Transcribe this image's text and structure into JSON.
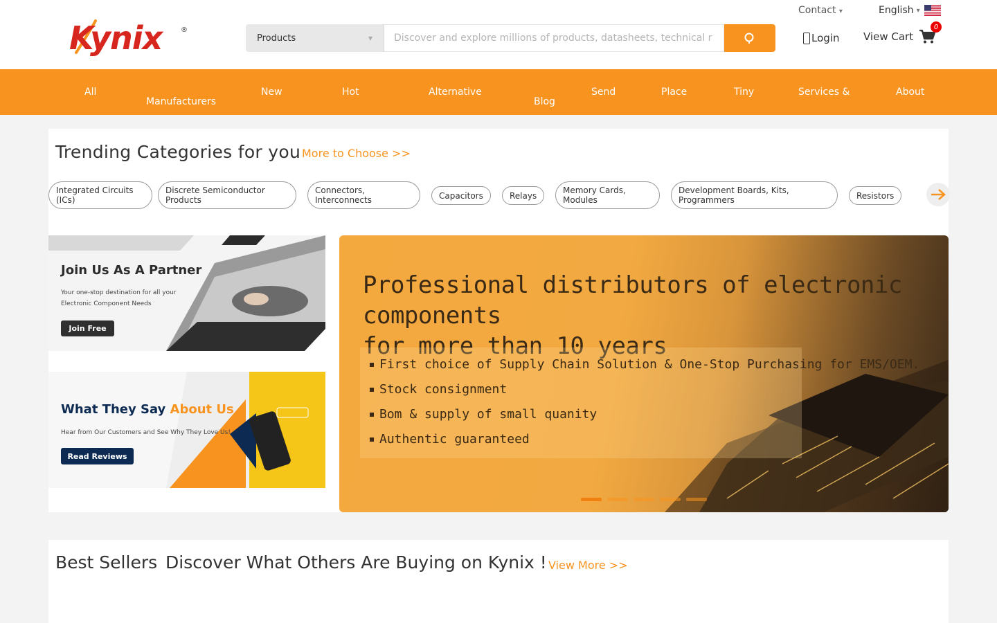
{
  "header": {
    "logo_text": "Kynix",
    "logo_mark": "®",
    "search": {
      "category": "Products",
      "placeholder": "Discover and explore millions of products, datasheets, technical r"
    },
    "contact_label": "Contact",
    "language_label": "English",
    "login_label": "Login",
    "cart_label": "View Cart",
    "cart_count": "0"
  },
  "nav": {
    "items": [
      {
        "label": "All",
        "label2": ""
      },
      {
        "label": "",
        "label2": "Manufacturers"
      },
      {
        "label": "New",
        "label2": ""
      },
      {
        "label": "Hot",
        "label2": ""
      },
      {
        "label": "Alternative",
        "label2": ""
      },
      {
        "label": "",
        "label2": "Blog"
      },
      {
        "label": "Send",
        "label2": ""
      },
      {
        "label": "Place",
        "label2": ""
      },
      {
        "label": "Tiny",
        "label2": ""
      },
      {
        "label": "Services &",
        "label2": ""
      },
      {
        "label": "About",
        "label2": ""
      }
    ]
  },
  "trending": {
    "title": "Trending Categories for you",
    "more_label": "More to Choose >>",
    "categories": [
      {
        "line1": "Integrated Circuits",
        "line2": "(ICs)"
      },
      {
        "line1": "Discrete Semiconductor",
        "line2": "Products"
      },
      {
        "line1": "Connectors,",
        "line2": "Interconnects"
      },
      {
        "line1": "Capacitors",
        "line2": ""
      },
      {
        "line1": "Relays",
        "line2": ""
      },
      {
        "line1": "Memory Cards,",
        "line2": "Modules"
      },
      {
        "line1": "Development Boards, Kits,",
        "line2": "Programmers"
      },
      {
        "line1": "Resistors",
        "line2": ""
      }
    ]
  },
  "banners": {
    "partner": {
      "title": "Join Us As A Partner",
      "sub1": "Your one-stop destination for all your",
      "sub2": "Electronic Component Needs",
      "button": "Join Free"
    },
    "reviews": {
      "title_a": "What They Say ",
      "title_b": "About Us",
      "sub": "Hear from Our Customers and See Why They Love Us!",
      "button": "Read Reviews"
    }
  },
  "hero": {
    "title_line1": "Professional distributors of electronic components",
    "title_line2": "for more than 10 years",
    "bullets": [
      "First choice of Supply Chain Solution & One-Stop Purchasing for EMS/OEM.",
      "Stock consignment",
      "Bom & supply of small quanity",
      "Authentic guaranteed"
    ],
    "slide_count": 5,
    "active_slide": 1
  },
  "best_sellers": {
    "title": "Best Sellers",
    "subtitle": "Discover What Others Are Buying on Kynix !",
    "more_label": "View More >>"
  },
  "colors": {
    "accent": "#f7931e",
    "logo_red": "#d7261e",
    "navy": "#0d2b52"
  }
}
